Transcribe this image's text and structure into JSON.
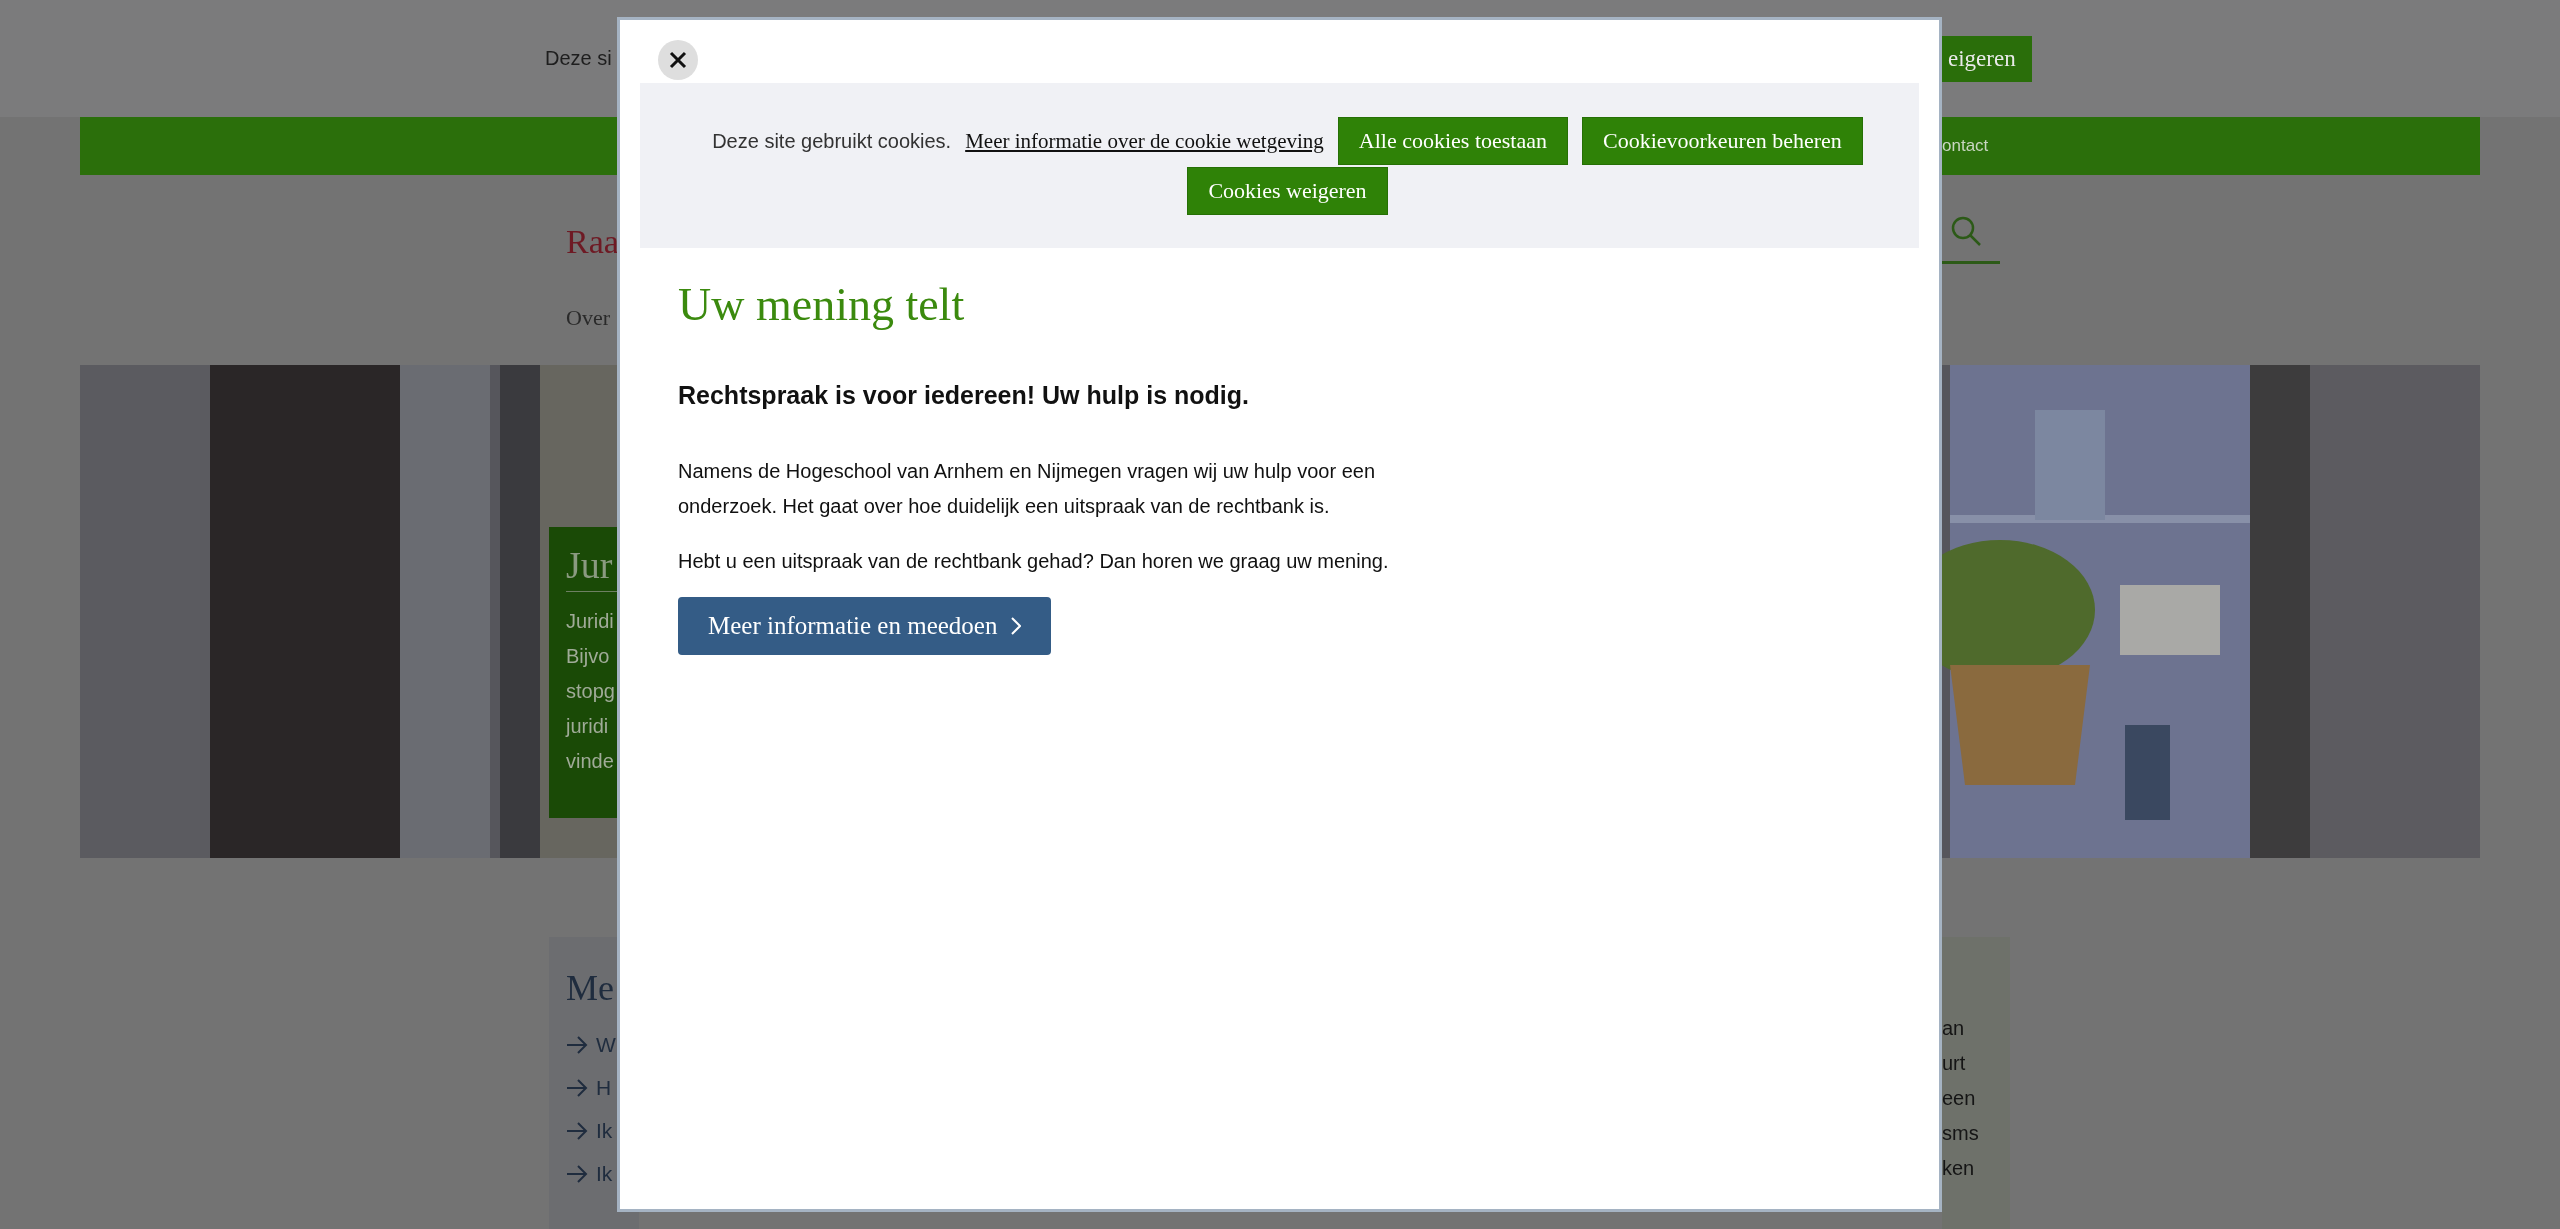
{
  "background_page": {
    "top_bar": {
      "text": "Deze si",
      "button": "eigeren"
    },
    "nav_bar": {
      "link": "ontact"
    },
    "header": {
      "logo_text": "Raa",
      "menu_item": "Over"
    },
    "hero": {
      "kind": "picture",
      "card_title": "Jur",
      "card_lines": [
        "Juridi",
        "Bijvo",
        "stopg",
        "juridi",
        "vinde"
      ]
    },
    "left_card": {
      "title": "Me",
      "links": [
        "W",
        "H",
        "Ik",
        "Ik"
      ]
    },
    "right_card": {
      "lines": [
        "an",
        "urt",
        "een",
        "sms",
        "ken"
      ]
    }
  },
  "modal": {
    "cookie_banner": {
      "text": "Deze site gebruikt cookies.",
      "link": "Meer informatie over de cookie wetgeving",
      "buttons": [
        "Alle cookies toestaan",
        "Cookievoorkeuren beheren",
        "Cookies weigeren"
      ]
    },
    "title": "Uw mening telt",
    "subtitle": "Rechtspraak is voor iedereen! Uw hulp is nodig.",
    "paragraphs": [
      "Namens de Hogeschool van Arnhem en Nijmegen vragen wij uw hulp voor een onderzoek. Het gaat over hoe duidelijk een uitspraak van de rechtbank is.",
      "Hebt u een uitspraak van de rechtbank gehad? Dan horen we graag uw mening."
    ],
    "cta_button": "Meer informatie en meedoen"
  }
}
